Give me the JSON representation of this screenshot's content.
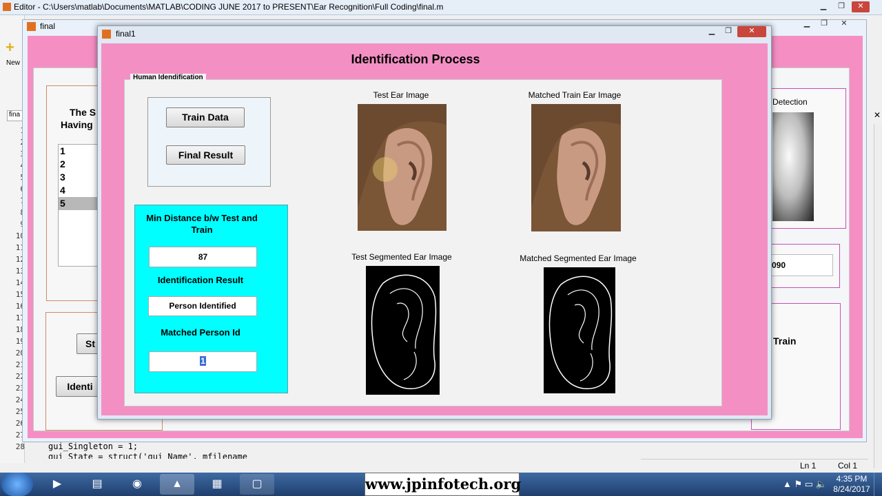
{
  "editor": {
    "title": "Editor - C:\\Users\\matlab\\Documents\\MATLAB\\CODING JUNE 2017 to PRESENT\\Ear Recognition\\Full Coding\\final.m",
    "new_label": "New",
    "tab_label": "fina",
    "line_numbers": [
      "1",
      "2",
      "3",
      "4",
      "5",
      "6",
      "7",
      "8",
      "9",
      "10",
      "11",
      "12",
      "13",
      "14",
      "15",
      "16",
      "17",
      "18",
      "19",
      "20",
      "21",
      "22",
      "23",
      "24",
      "25",
      "26",
      "27",
      "28"
    ],
    "code_line_28": "gui_Singleton = 1;",
    "code_line_29": "gui_State = struct('gui_Name',       mfilename",
    "status_ln": "Ln  1",
    "status_col": "Col  1"
  },
  "final_window": {
    "title": "final",
    "left_panel_text_1": "The S",
    "left_panel_text_2": "Having",
    "list_items": [
      "1",
      "2",
      "3",
      "4",
      "5"
    ],
    "selected_index": 4,
    "button_st": "St",
    "button_identi": "Identi",
    "right_detection": "Detection",
    "right_value": "090",
    "right_train": "Train"
  },
  "final1_window": {
    "title": "final1",
    "heading": "Identification Process",
    "group_label": "Human Idendification",
    "train_button": "Train Data",
    "final_button": "Final Result",
    "min_distance_label": "Min Distance b/w Test and Train",
    "min_distance_value": "87",
    "identification_result_label": "Identification Result",
    "identification_result_value": "Person Identified",
    "matched_person_label": "Matched Person Id",
    "matched_person_value": "1",
    "test_ear_caption": "Test Ear Image",
    "matched_train_caption": "Matched Train Ear Image",
    "test_segmented_caption": "Test Segmented Ear Image",
    "matched_segmented_caption": "Matched Segmented Ear Image"
  },
  "taskbar": {
    "watermark": "www.jpinfotech.org",
    "time": "4:35 PM",
    "date": "8/24/2017"
  },
  "colors": {
    "pink": "#f48fc4",
    "cyan": "#00ffff",
    "skin": "#c99a82"
  }
}
